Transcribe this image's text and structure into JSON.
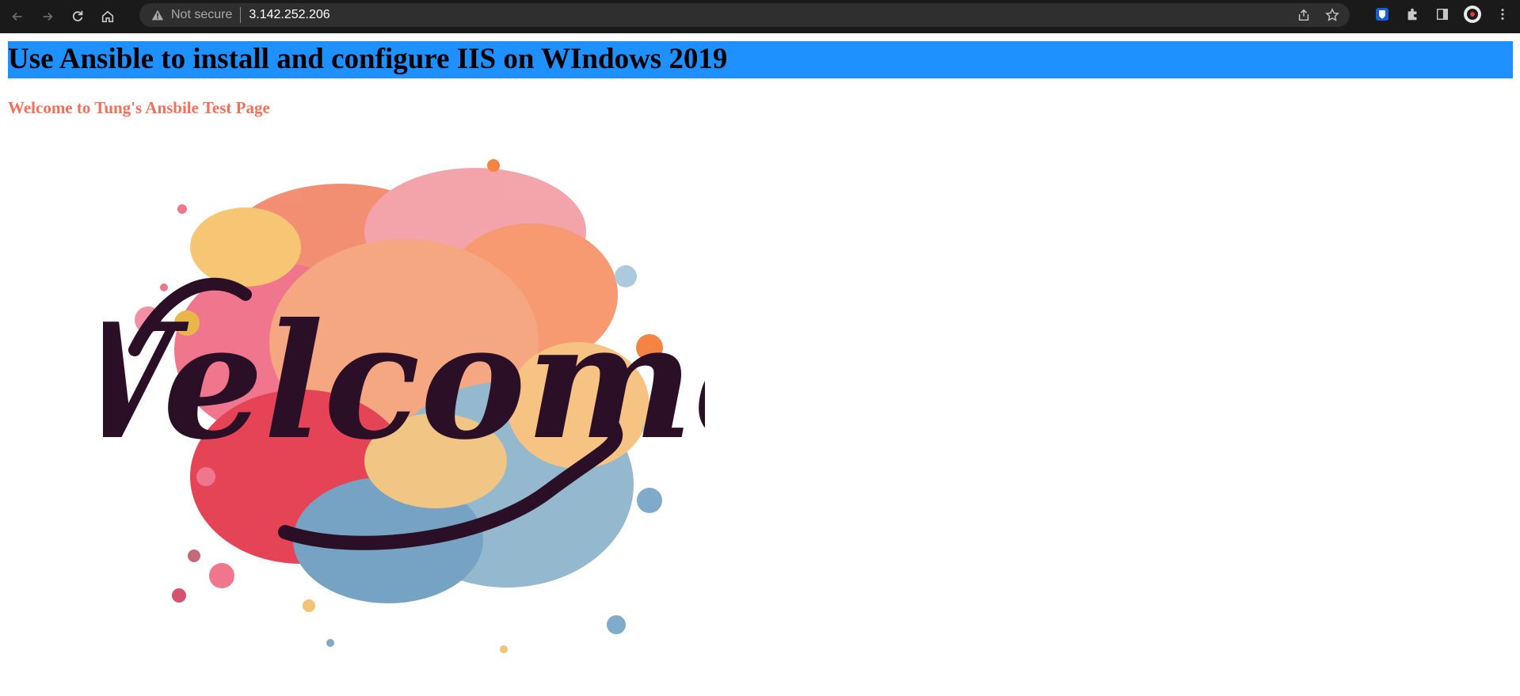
{
  "browser": {
    "security_status": "Not secure",
    "url": "3.142.252.206"
  },
  "page": {
    "heading": "Use Ansible to install and configure IIS on WIndows 2019",
    "subheading": "Welcome to Tung's Ansbile Test Page",
    "image_text": "Welcome"
  },
  "colors": {
    "heading_bg": "#1e90ff",
    "subheading": "#f0705a"
  }
}
